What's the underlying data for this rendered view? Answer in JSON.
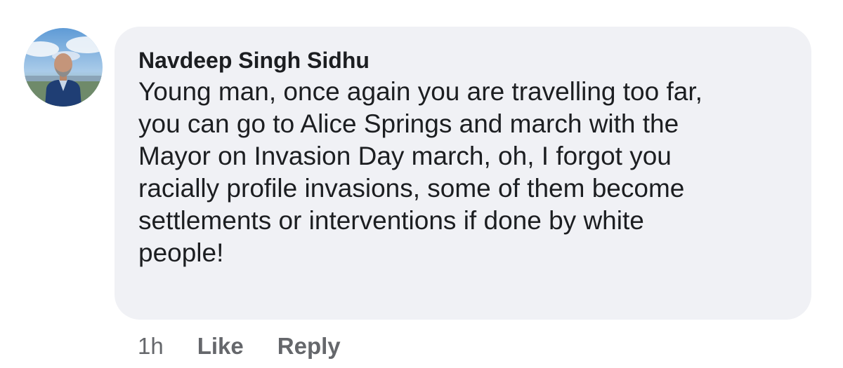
{
  "comment": {
    "author": "Navdeep Singh Sidhu",
    "text": "Young man, once again you are travelling too far,\nyou can go to Alice Springs and march with the\nMayor on Invasion Day march, oh, I forgot you\nracially profile invasions, some of them become\nsettlements or interventions if done by white\npeople!",
    "timestamp": "1h",
    "like_label": "Like",
    "reply_label": "Reply"
  },
  "avatar": {
    "icon": "profile-photo"
  },
  "colors": {
    "bubble_bg": "#f0f1f5",
    "text": "#1c1e21",
    "meta": "#65676b"
  }
}
